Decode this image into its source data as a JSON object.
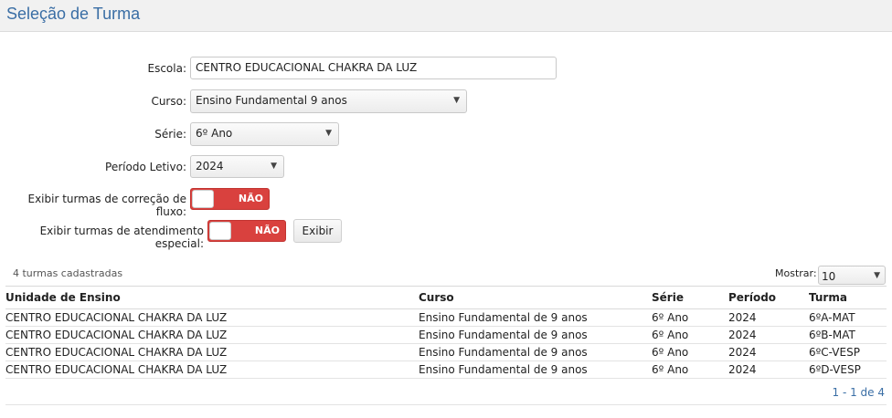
{
  "page": {
    "title": "Seleção de Turma"
  },
  "form": {
    "escola_label": "Escola:",
    "escola_value": "CENTRO EDUCACIONAL CHAKRA DA LUZ",
    "curso_label": "Curso:",
    "curso_value": "Ensino Fundamental 9 anos",
    "serie_label": "Série:",
    "serie_value": "6º Ano",
    "periodo_label": "Período Letivo:",
    "periodo_value": "2024",
    "fluxo_label": "Exibir turmas de correção de fluxo:",
    "fluxo_toggle": "NÃO",
    "especial_label": "Exibir turmas de atendimento especial:",
    "especial_toggle": "NÃO",
    "exibir_button": "Exibir"
  },
  "list": {
    "count_text": "4 turmas cadastradas",
    "mostrar_label": "Mostrar:",
    "mostrar_value": "10",
    "columns": [
      "Unidade de Ensino",
      "Curso",
      "Série",
      "Período",
      "Turma"
    ],
    "rows": [
      [
        "CENTRO EDUCACIONAL CHAKRA DA LUZ",
        "Ensino Fundamental de 9 anos",
        "6º Ano",
        "2024",
        "6ºA-MAT"
      ],
      [
        "CENTRO EDUCACIONAL CHAKRA DA LUZ",
        "Ensino Fundamental de 9 anos",
        "6º Ano",
        "2024",
        "6ºB-MAT"
      ],
      [
        "CENTRO EDUCACIONAL CHAKRA DA LUZ",
        "Ensino Fundamental de 9 anos",
        "6º Ano",
        "2024",
        "6ºC-VESP"
      ],
      [
        "CENTRO EDUCACIONAL CHAKRA DA LUZ",
        "Ensino Fundamental de 9 anos",
        "6º Ano",
        "2024",
        "6ºD-VESP"
      ]
    ],
    "pager_text": "1 - 1 de 4"
  },
  "colors": {
    "accent": "#3a6ea5",
    "toggle_off": "#d9413e"
  }
}
